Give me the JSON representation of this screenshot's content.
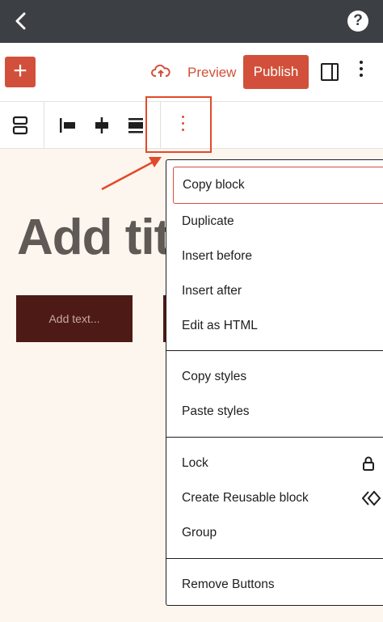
{
  "topbar": {
    "back_icon": "chevron-left-icon",
    "help_label": "?"
  },
  "toolbar": {
    "add_label": "+",
    "preview_label": "Preview",
    "publish_label": "Publish",
    "accent_color": "#d2503b"
  },
  "content": {
    "title_placeholder": "Add tit",
    "button_placeholder": "Add text..."
  },
  "menu": {
    "groups": [
      {
        "items": [
          {
            "label": "Copy block"
          },
          {
            "label": "Duplicate"
          },
          {
            "label": "Insert before"
          },
          {
            "label": "Insert after"
          },
          {
            "label": "Edit as HTML"
          }
        ]
      },
      {
        "items": [
          {
            "label": "Copy styles"
          },
          {
            "label": "Paste styles"
          }
        ]
      },
      {
        "items": [
          {
            "label": "Lock",
            "icon": "lock-icon"
          },
          {
            "label": "Create Reusable block",
            "icon": "reusable-block-icon"
          },
          {
            "label": "Group"
          }
        ]
      },
      {
        "items": [
          {
            "label": "Remove Buttons"
          }
        ]
      }
    ]
  }
}
